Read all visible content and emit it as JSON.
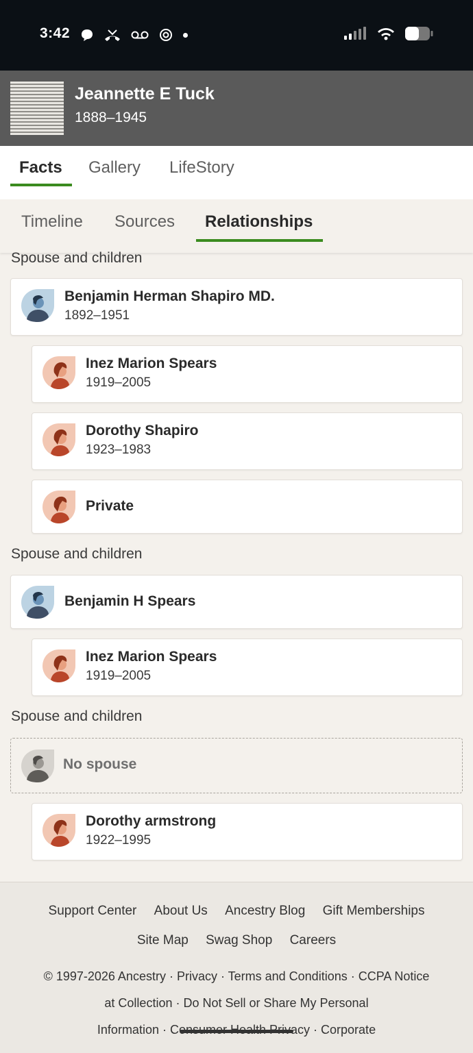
{
  "status": {
    "time": "3:42"
  },
  "person": {
    "name": "Jeannette E Tuck",
    "dates": "1888–1945"
  },
  "main_tabs": [
    {
      "label": "Facts"
    },
    {
      "label": "Gallery"
    },
    {
      "label": "LifeStory"
    }
  ],
  "sub_tabs": [
    {
      "label": "Timeline"
    },
    {
      "label": "Sources"
    },
    {
      "label": "Relationships"
    }
  ],
  "families": [
    {
      "label": "Spouse and children",
      "spouse": {
        "name": "Benjamin Herman Shapiro MD.",
        "dates": "1892–1951"
      },
      "children": [
        {
          "name": "Inez Marion Spears",
          "dates": "1919–2005"
        },
        {
          "name": "Dorothy Shapiro",
          "dates": "1923–1983"
        },
        {
          "name": "Private",
          "dates": ""
        }
      ]
    },
    {
      "label": "Spouse and children",
      "spouse": {
        "name": "Benjamin H Spears",
        "dates": ""
      },
      "children": [
        {
          "name": "Inez Marion Spears",
          "dates": "1919–2005"
        }
      ]
    },
    {
      "label": "Spouse and children",
      "spouse": {
        "name": "No spouse",
        "dates": ""
      },
      "children": [
        {
          "name": "Dorothy armstrong",
          "dates": "1922–1995"
        }
      ]
    }
  ],
  "footer": {
    "links_row1": [
      "Support Center",
      "About Us",
      "Ancestry Blog",
      "Gift Memberships"
    ],
    "links_row2": [
      "Site Map",
      "Swag Shop",
      "Careers"
    ],
    "legal_line1": "© 1997-2026 Ancestry · Privacy · Terms and Conditions · CCPA Notice",
    "legal_line2": "at Collection · Do Not Sell or Share My Personal",
    "legal_line3": "Information · Consumer Health Privacy · Corporate"
  },
  "colors": {
    "accent": "#3b8b1f",
    "male_avatar": "#4a6d8c",
    "female_avatar": "#c0563a"
  },
  "icons": [
    "chat-bubble-icon",
    "missed-call-icon",
    "voicemail-icon",
    "openai-icon",
    "signal-icon",
    "wifi-icon",
    "battery-icon",
    "male-avatar-icon",
    "female-avatar-icon",
    "unknown-avatar-icon"
  ]
}
